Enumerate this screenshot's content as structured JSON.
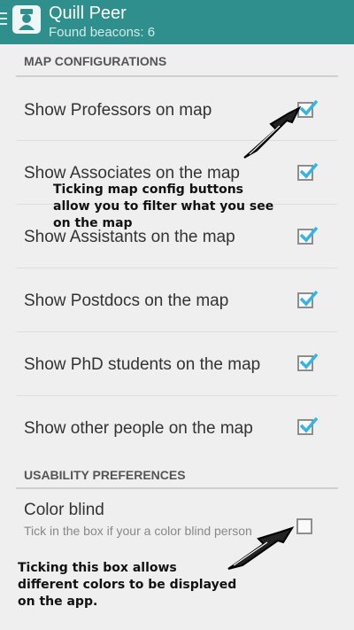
{
  "app": {
    "title": "Quill Peer",
    "subtitle": "Found beacons: 6",
    "menu_icon": "hamburger-icon",
    "logo_icon": "user-badge-icon"
  },
  "sections": {
    "map": {
      "header": "MAP CONFIGURATIONS"
    },
    "usability": {
      "header": "USABILITY PREFERENCES"
    }
  },
  "map_settings": [
    {
      "label": "Show Professors on map",
      "checked": true
    },
    {
      "label": "Show Associates on the map",
      "checked": true
    },
    {
      "label": "Show Assistants on the map",
      "checked": true
    },
    {
      "label": "Show Postdocs on the map",
      "checked": true
    },
    {
      "label": "Show PhD students on the map",
      "checked": true
    },
    {
      "label": "Show other people on the map",
      "checked": true
    }
  ],
  "usability_settings": {
    "label": "Color blind",
    "summary": "Tick in the box if your a color blind person",
    "checked": false
  },
  "annotations": {
    "map_note": "Ticking map config buttons allow you to filter what you see on the map",
    "color_note": "Ticking this box allows different colors to be displayed on the app."
  },
  "colors": {
    "appbar": "#2f8f8c",
    "checkmark": "#33b5e5",
    "background": "#efefef"
  }
}
